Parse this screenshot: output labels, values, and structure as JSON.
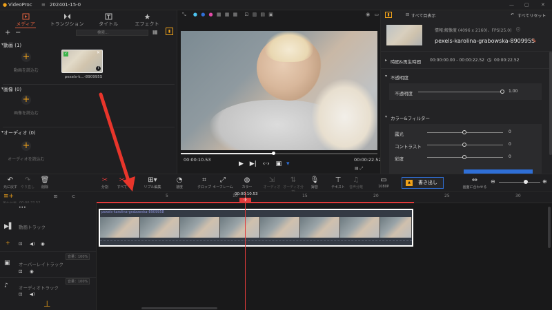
{
  "titlebar": {
    "app_name": "VideoProc",
    "project": "202401-15-0"
  },
  "media_tabs": [
    {
      "label": "メディア",
      "active": true
    },
    {
      "label": "トランジション",
      "active": false
    },
    {
      "label": "タイトル",
      "active": false
    },
    {
      "label": "エフェクト",
      "active": false
    }
  ],
  "media_panel": {
    "search_placeholder": "検索...",
    "video_section": "動画 (1)",
    "video_add_label": "動画を読込む",
    "clip_name": "pexels-k...-890995S",
    "image_section": "画像 (0)",
    "image_add_label": "画像を読込む",
    "audio_section": "オーディオ (0)",
    "audio_add_label": "オーディオを読込む"
  },
  "preview": {
    "current_time": "00:00:10.53",
    "total_time": "00:00:22.52",
    "progress": 0.47
  },
  "props": {
    "show_all": "すべて目表示",
    "reset_all": "すべてリセット",
    "resolution": "解像度 (4096 x 2160)、FPS(25.0)",
    "resolution_prefix": "情報:",
    "clip_title": "pexels-karolina-grabowska-890995S",
    "time_section": "時間&再生時間",
    "time_range": "00:00:00.00 - 00:00:22.52",
    "duration": "00:00:22.52",
    "opacity_section": "不透明度",
    "opacity_label": "不透明度",
    "opacity_value": "1.00",
    "color_section": "カラー&フィルター",
    "exposure_label": "露光",
    "exposure_value": "0",
    "contrast_label": "コントラスト",
    "contrast_value": "0",
    "saturation_label": "彩度",
    "saturation_value": "0"
  },
  "toolbar": {
    "undo": "元に戻す",
    "redo": "やり直し",
    "delete": "削除",
    "split": "分割",
    "split_all": "すべて",
    "ripple": "リプル編集",
    "speed": "速度",
    "crop": "クロップ",
    "keyframe": "キーフレーム",
    "color": "カラー",
    "audio_detach": "オーディオ",
    "audio_split": "オーディオ分割",
    "record": "録音",
    "text": "テキスト",
    "freeze": "音声分離",
    "resolution": "1080P",
    "export": "書き出し",
    "fit": "画面に合わせる"
  },
  "timeline": {
    "playhead_time": "00:00:10.53",
    "start_label": "再生位置",
    "start_time": "00:00:22.52",
    "ticks": [
      "5",
      "10",
      "15",
      "20",
      "25",
      "30"
    ],
    "clip_label": "pexels-karolina-grabowska-8909958",
    "tracks": [
      {
        "name": "動画トラック"
      },
      {
        "name": "オーバーレイトラック",
        "volume": "音量：100%"
      },
      {
        "name": "オーディオトラック",
        "volume": "音量：100%"
      }
    ]
  },
  "colors": {
    "accent": "#e2603e",
    "playhead": "#e23b3b",
    "add_icon": "#f0a21a",
    "export_border": "#2f6fd6"
  }
}
